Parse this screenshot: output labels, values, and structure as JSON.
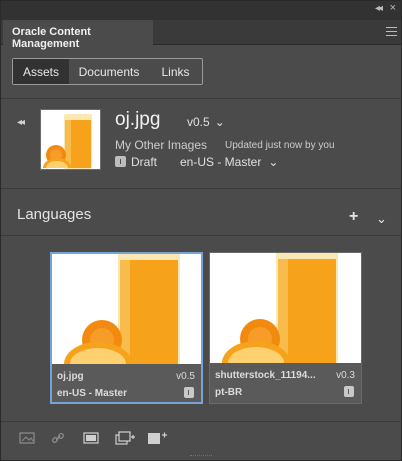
{
  "window": {
    "collapse_icon": "double-chevron-left-icon",
    "close_icon": "close-icon"
  },
  "panel": {
    "title": "Oracle Content Management",
    "menu_icon": "hamburger-icon"
  },
  "tabs": [
    {
      "label": "Assets",
      "active": true
    },
    {
      "label": "Documents",
      "active": false
    },
    {
      "label": "Links",
      "active": false
    }
  ],
  "asset": {
    "name": "oj.jpg",
    "version": "v0.5",
    "collection": "My Other Images",
    "updated": "Updated just now by you",
    "status": "Draft",
    "locale": "en-US - Master"
  },
  "languages": {
    "heading": "Languages",
    "cards": [
      {
        "name": "oj.jpg",
        "version": "v0.5",
        "locale": "en-US - Master",
        "selected": true
      },
      {
        "name": "shutterstock_11194...",
        "version": "v0.3",
        "locale": "pt-BR",
        "selected": false
      }
    ]
  },
  "toolbar": {
    "icons": [
      "image-icon",
      "link-icon",
      "place-icon",
      "duplicate-icon",
      "add-image-icon"
    ]
  },
  "colors": {
    "panel_bg": "#4b4b4b",
    "header_bg": "#323232",
    "selection": "#7aa2d4",
    "orange": "#f7a21b"
  }
}
